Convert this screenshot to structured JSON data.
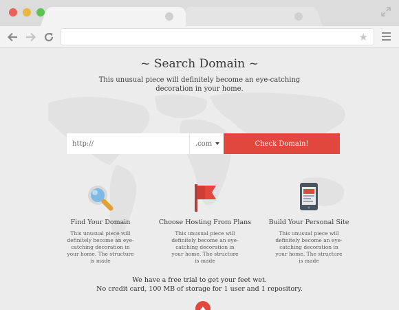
{
  "browser": {
    "window_controls": [
      "close",
      "minimize",
      "maximize"
    ],
    "tabs": [
      {
        "active": true
      },
      {
        "active": false
      }
    ],
    "toolbar": {
      "back_icon": "back-arrow-icon",
      "forward_icon": "forward-arrow-icon",
      "reload_icon": "reload-icon",
      "address_value": "",
      "bookmark_icon": "star-icon",
      "menu_icon": "hamburger-menu-icon"
    }
  },
  "hero": {
    "title": "~ Search Domain ~",
    "subtitle": "This unusual piece will definitely become an eye-catching decoration in your home."
  },
  "search": {
    "url_placeholder": "http://",
    "tld_selected": ".com",
    "button_label": "Check Domain!"
  },
  "features": [
    {
      "icon": "magnifier-icon",
      "title": "Find Your Domain",
      "description": "This unusual piece will definitely become an eye-catching decoration in your home. The structure is made"
    },
    {
      "icon": "flag-icon",
      "title": "Choose Hosting From Plans",
      "description": "This unusual piece will definitely become an eye-catching decoration in your home. The structure is made"
    },
    {
      "icon": "tablet-icon",
      "title": "Build Your Personal Site",
      "description": "This unusual piece will definitely become an eye-catching decoration in your home. The structure is made"
    }
  ],
  "trial": {
    "line1": "We have a free trial to get your feet wet.",
    "line2": "No credit card, 100 MB of storage for 1 user and 1 repository."
  },
  "colors": {
    "accent": "#e2473e",
    "background": "#ececec",
    "chrome": "#dcdcdc"
  }
}
